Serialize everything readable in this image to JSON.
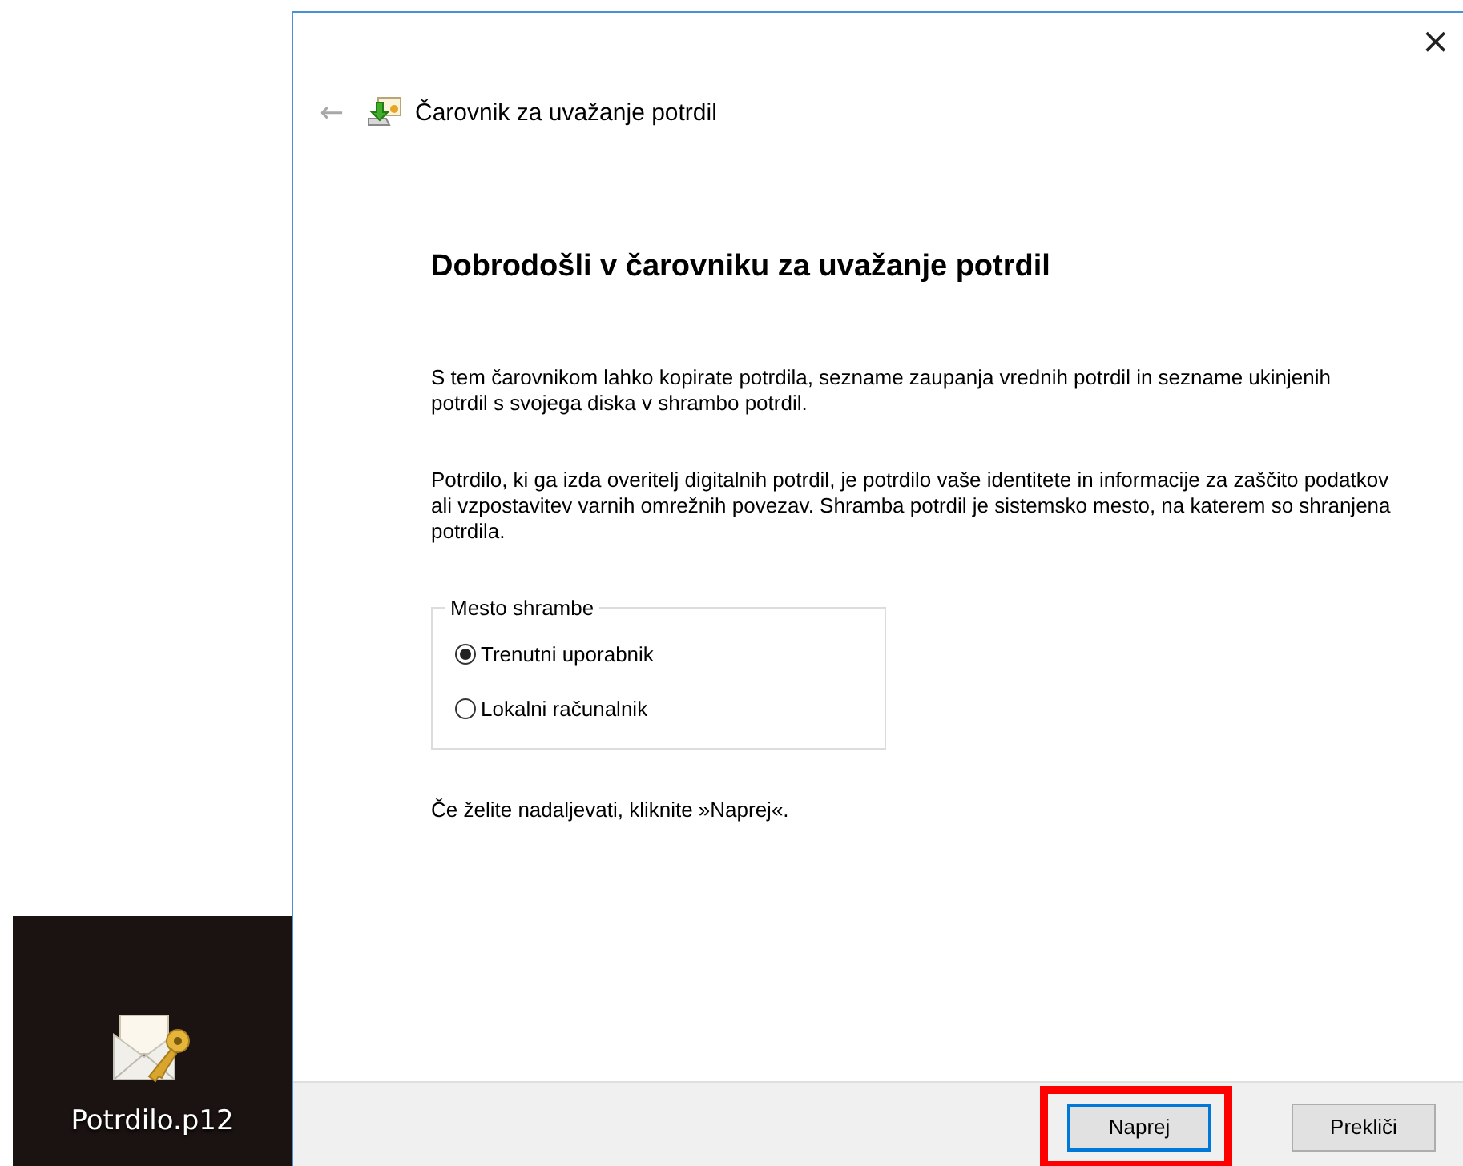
{
  "desktop_icon": {
    "label": "Potrdilo.p12"
  },
  "window": {
    "title": "Čarovnik za uvažanje potrdil",
    "close": "×",
    "back": "←"
  },
  "heading": "Dobrodošli v čarovniku za uvažanje potrdil",
  "paragraphs": [
    "S tem čarovnikom lahko kopirate potrdila, sezname zaupanja vrednih potrdil in sezname ukinjenih potrdil s svojega diska v shrambo potrdil.",
    "Potrdilo, ki ga izda overitelj digitalnih potrdil, je potrdilo vaše identitete in informacije za zaščito podatkov ali vzpostavitev varnih omrežnih povezav. Shramba potrdil je sistemsko mesto, na katerem so shranjena potrdila."
  ],
  "store_location": {
    "legend": "Mesto shrambe",
    "options": [
      {
        "label": "Trenutni uporabnik",
        "selected": true
      },
      {
        "label": "Lokalni računalnik",
        "selected": false
      }
    ]
  },
  "instruction": "Če želite nadaljevati, kliknite »Naprej«.",
  "buttons": [
    {
      "label": "Naprej",
      "default": true,
      "highlighted": true
    },
    {
      "label": "Prekliči",
      "default": false,
      "highlighted": false
    }
  ]
}
